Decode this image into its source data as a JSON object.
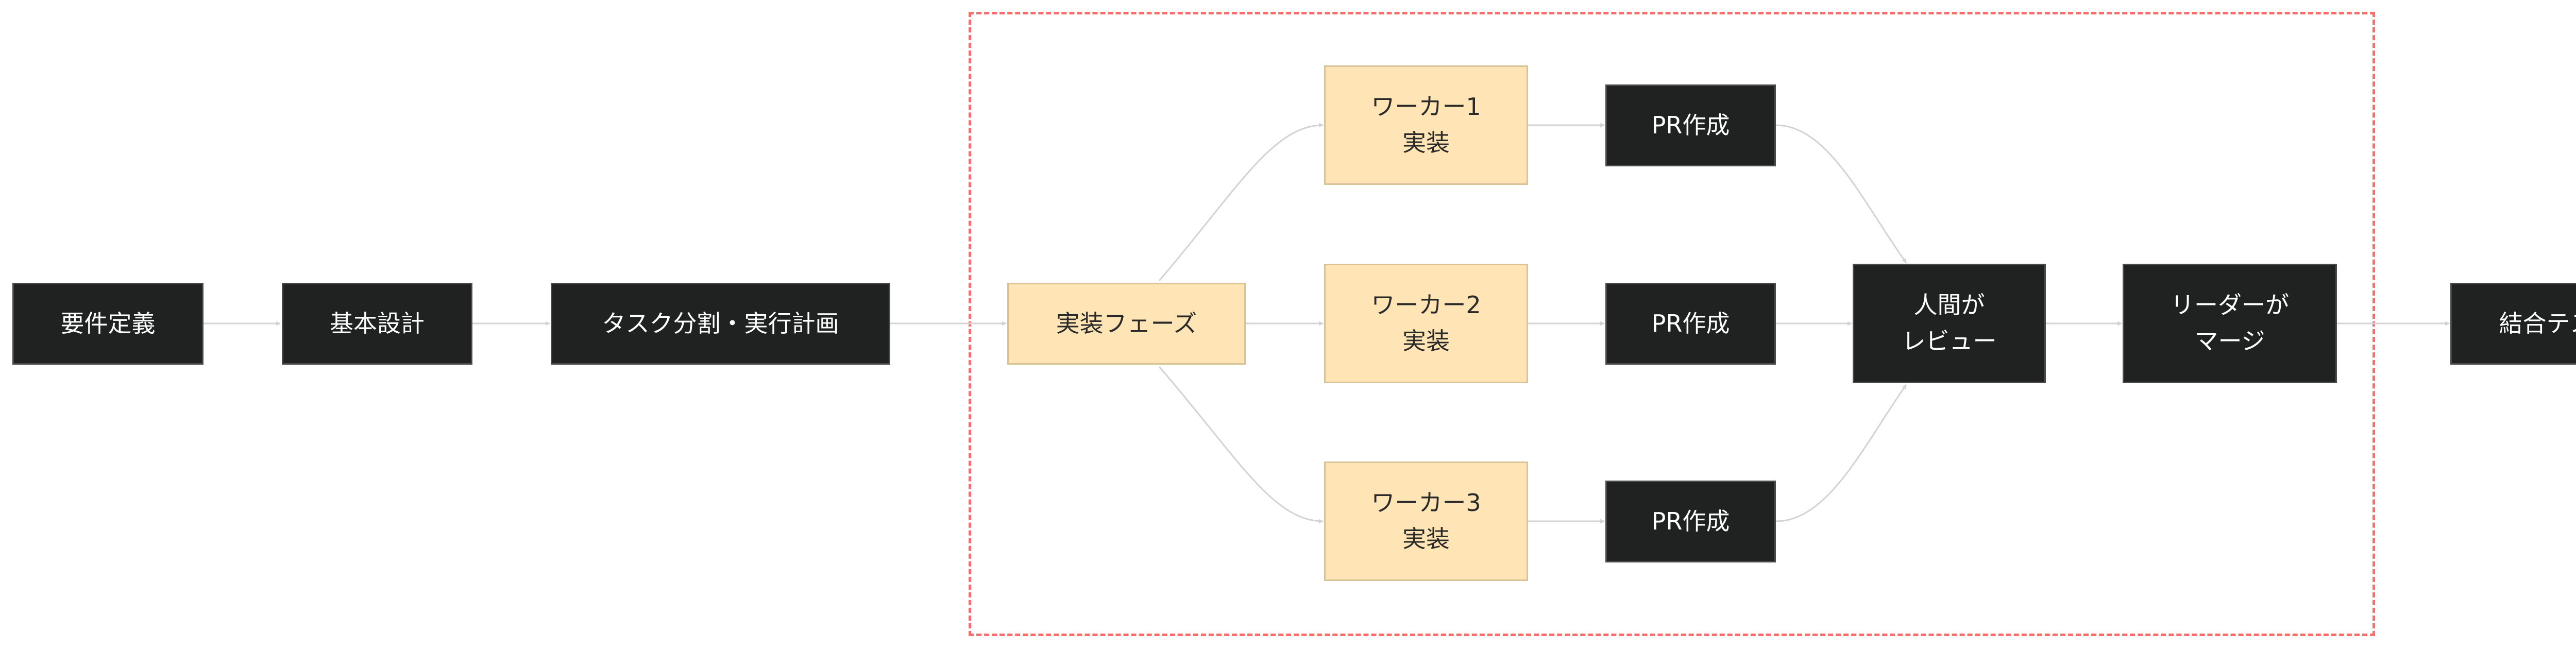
{
  "diagram": {
    "nodes": {
      "requirements": "要件定義",
      "basic_design": "基本設計",
      "task_split": "タスク分割・実行計画",
      "impl_phase": "実装フェーズ",
      "worker1": {
        "line1": "ワーカー1",
        "line2": "実装"
      },
      "worker2": {
        "line1": "ワーカー2",
        "line2": "実装"
      },
      "worker3": {
        "line1": "ワーカー3",
        "line2": "実装"
      },
      "pr1": "PR作成",
      "pr2": "PR作成",
      "pr3": "PR作成",
      "human_review": {
        "line1": "人間が",
        "line2": "レビュー"
      },
      "leader_merge": {
        "line1": "リーダーが",
        "line2": "マージ"
      },
      "integration_test": "結合テスト"
    },
    "colors": {
      "dark_node": "#202221",
      "light_node": "#ffe4b5",
      "edge": "#d3d3d3",
      "boundary": "#ff6b6b"
    }
  }
}
